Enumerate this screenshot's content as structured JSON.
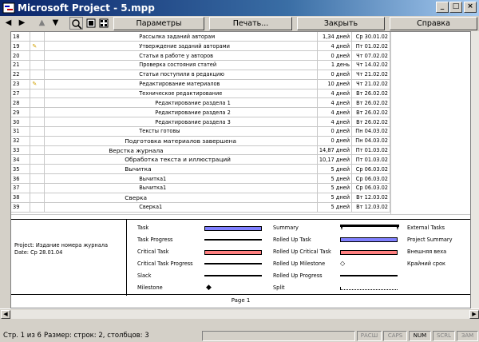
{
  "window": {
    "title": "Microsoft Project - 5.mpp"
  },
  "toolbar": {
    "page_setup_label": "Параметры страницы...",
    "print_label": "Печать...",
    "close_label": "Закрыть",
    "help_label": "Справка"
  },
  "tasks": [
    {
      "id": "18",
      "indicator": "",
      "name": "Рассылка заданий авторам",
      "duration": "1,34 дней",
      "finish": "Ср 30.01.02",
      "level": 3
    },
    {
      "id": "19",
      "indicator": "✎",
      "name": "Утверждение заданий авторами",
      "duration": "4 дней",
      "finish": "Пт 01.02.02",
      "level": 3
    },
    {
      "id": "20",
      "indicator": "",
      "name": "Статьи в работе у авторов",
      "duration": "0 дней",
      "finish": "Чт 07.02.02",
      "level": 3
    },
    {
      "id": "21",
      "indicator": "",
      "name": "Проверка состояния статей",
      "duration": "1 день",
      "finish": "Чт 14.02.02",
      "level": 3
    },
    {
      "id": "22",
      "indicator": "",
      "name": "Статьи поступили в редакцию",
      "duration": "0 дней",
      "finish": "Чт 21.02.02",
      "level": 3
    },
    {
      "id": "23",
      "indicator": "✎",
      "name": "Редактирование материалов",
      "duration": "10 дней",
      "finish": "Чт 21.02.02",
      "level": 3
    },
    {
      "id": "27",
      "indicator": "",
      "name": "Техническое редактирование",
      "duration": "4 дней",
      "finish": "Вт 26.02.02",
      "level": 3
    },
    {
      "id": "28",
      "indicator": "",
      "name": "Редактирование раздела 1",
      "duration": "4 дней",
      "finish": "Вт 26.02.02",
      "level": 4
    },
    {
      "id": "29",
      "indicator": "",
      "name": "Редактирование раздела 2",
      "duration": "4 дней",
      "finish": "Вт 26.02.02",
      "level": 4
    },
    {
      "id": "30",
      "indicator": "",
      "name": "Редактирование раздела 3",
      "duration": "4 дней",
      "finish": "Вт 26.02.02",
      "level": 4
    },
    {
      "id": "31",
      "indicator": "",
      "name": "Тексты готовы",
      "duration": "0 дней",
      "finish": "Пн 04.03.02",
      "level": 3
    },
    {
      "id": "32",
      "indicator": "",
      "name": "Подготовка материалов завершена",
      "duration": "0 дней",
      "finish": "Пн 04.03.02",
      "level": 2
    },
    {
      "id": "33",
      "indicator": "",
      "name": "Верстка журнала",
      "duration": "14,87 дней",
      "finish": "Пт 01.03.02",
      "level": 1
    },
    {
      "id": "34",
      "indicator": "",
      "name": "Обработка текста и иллюстраций",
      "duration": "10,17 дней",
      "finish": "Пт 01.03.02",
      "level": 2
    },
    {
      "id": "35",
      "indicator": "",
      "name": "Вычитка",
      "duration": "5 дней",
      "finish": "Ср 06.03.02",
      "level": 2
    },
    {
      "id": "36",
      "indicator": "",
      "name": "Вычитка1",
      "duration": "5 дней",
      "finish": "Ср 06.03.02",
      "level": 3
    },
    {
      "id": "37",
      "indicator": "",
      "name": "Вычитка1",
      "duration": "5 дней",
      "finish": "Ср 06.03.02",
      "level": 3
    },
    {
      "id": "38",
      "indicator": "",
      "name": "Сверка",
      "duration": "5 дней",
      "finish": "Вт 12.03.02",
      "level": 2
    },
    {
      "id": "39",
      "indicator": "",
      "name": "Сверка1",
      "duration": "5 дней",
      "finish": "Вт 12.03.02",
      "level": 3
    }
  ],
  "legend": {
    "project_label": "Project: Издание номера журнала",
    "date_label": "Date: Ср 28.01.04",
    "col1": [
      "Task",
      "Task Progress",
      "Critical Task",
      "Critical Task Progress",
      "Slack",
      "Milestone"
    ],
    "col2": [
      "Summary",
      "Rolled Up Task",
      "Rolled Up Critical Task",
      "Rolled Up Milestone",
      "Rolled Up Progress",
      "Split"
    ],
    "col3": [
      "External Tasks",
      "Project Summary",
      "Внешняя веха",
      "Крайний срок"
    ],
    "colors": {
      "task_blue": "#8080ff",
      "critical_red": "#ff8080",
      "black": "#000000"
    }
  },
  "page_footer": "Page 1",
  "statusbar": {
    "left": "Стр. 1 из 6",
    "size": "Размер: строк: 2, столбцов: 3",
    "ext": "РАСШ",
    "caps": "CAPS",
    "num": "NUM",
    "scrl": "SCRL",
    "ovr": "ЗАМ"
  }
}
